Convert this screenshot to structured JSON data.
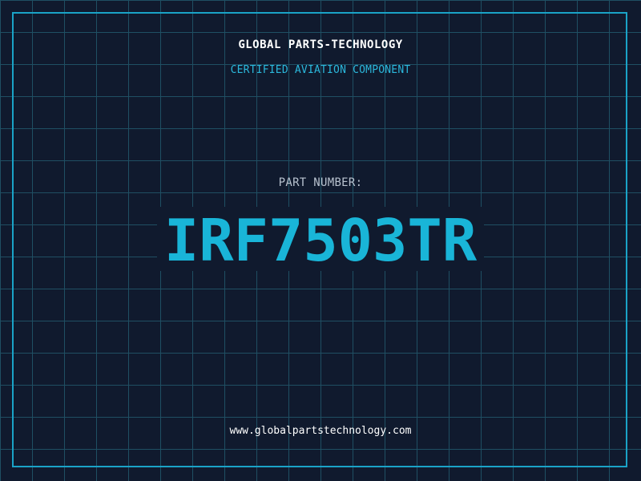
{
  "header": {
    "company": "GLOBAL PARTS-TECHNOLOGY",
    "tagline": "CERTIFIED AVIATION COMPONENT"
  },
  "part": {
    "label": "PART NUMBER:",
    "number": "IRF7503TR"
  },
  "footer": {
    "url": "www.globalpartstechnology.com"
  },
  "colors": {
    "background": "#101a2e",
    "grid": "#1f4f63",
    "accent": "#19b5d8",
    "frame": "#1aa3c7"
  }
}
